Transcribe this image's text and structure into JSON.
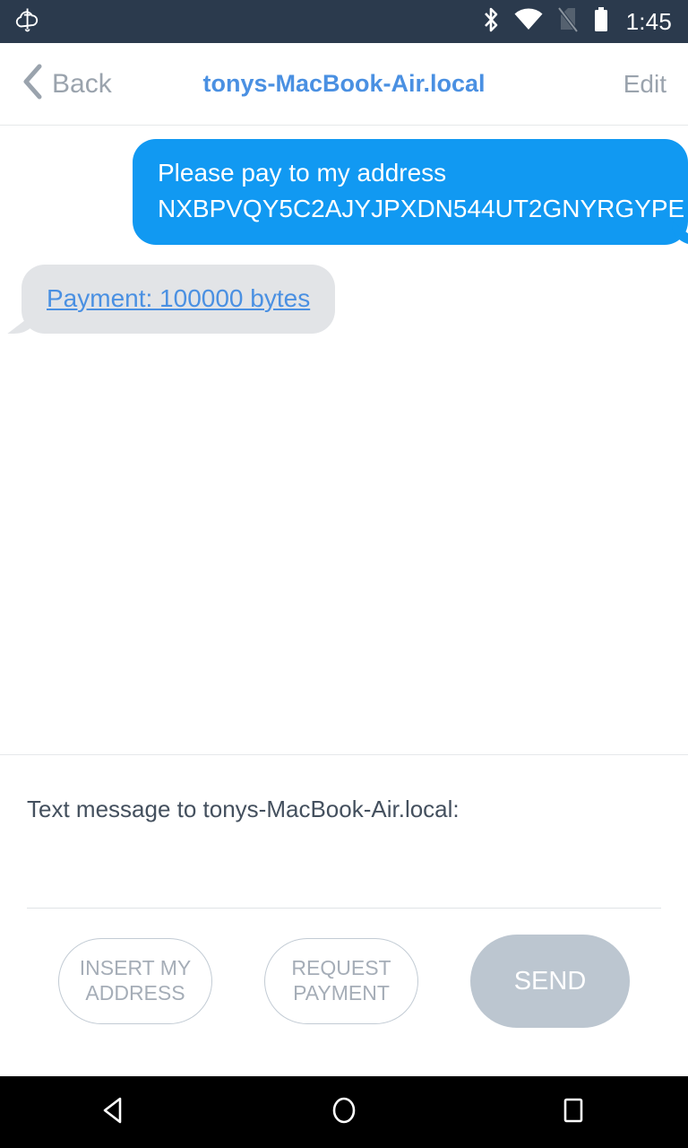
{
  "status_bar": {
    "notification_icon": "cloud-sword-icon",
    "icons": [
      "bluetooth-icon",
      "wifi-icon",
      "no-sim-icon",
      "battery-full-icon"
    ],
    "time": "1:45",
    "background_color": "#2b3a4d"
  },
  "app_bar": {
    "back_label": "Back",
    "title": "tonys-MacBook-Air.local",
    "edit_label": "Edit",
    "title_color": "#4a90e2",
    "muted_color": "#9aa3ad"
  },
  "conversation": {
    "messages": [
      {
        "direction": "out",
        "line1": "Please pay to my address",
        "line2": "NXBPVQY5C2AJYJPXDN544UT2GNYRGYPE",
        "bubble_color": "#1199f2",
        "text_color": "#ffffff"
      },
      {
        "direction": "in",
        "link_text": "Payment: 100000 bytes",
        "bubble_color": "#e2e4e7",
        "text_color": "#4a90e2"
      }
    ]
  },
  "composer": {
    "label": "Text message to tonys-MacBook-Air.local:",
    "input_value": "",
    "input_placeholder": "",
    "buttons": [
      {
        "label_line1": "INSERT MY",
        "label_line2": "ADDRESS",
        "style": "outline"
      },
      {
        "label_line1": "REQUEST",
        "label_line2": "PAYMENT",
        "style": "outline"
      },
      {
        "label_line1": "SEND",
        "label_line2": "",
        "style": "filled"
      }
    ],
    "send_button_color": "#bcc6d0"
  },
  "nav_bar": {
    "back": "nav-back-icon",
    "home": "nav-home-icon",
    "recents": "nav-recents-icon",
    "background_color": "#000000"
  }
}
